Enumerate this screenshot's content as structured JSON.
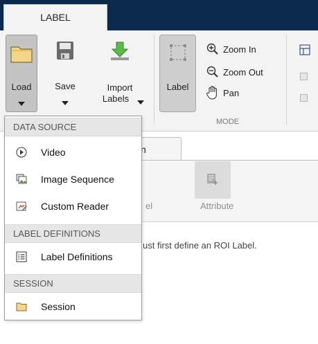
{
  "tabs": [
    {
      "label": "LABEL"
    }
  ],
  "ribbon": {
    "load": {
      "label": "Load"
    },
    "save": {
      "label": "Save"
    },
    "import": {
      "label_line1": "Import",
      "label_line2": "Labels"
    },
    "label": {
      "label": "Label"
    },
    "zoom_in": {
      "label": "Zoom In"
    },
    "zoom_out": {
      "label": "Zoom Out"
    },
    "pan": {
      "label": "Pan"
    },
    "sections": {
      "mode": "MODE"
    }
  },
  "document": {
    "tab_label_partial": "n",
    "attribute_label": "Attribute",
    "label_partial": "el",
    "hint": "ust first define an ROI Label."
  },
  "menu": {
    "sections": [
      {
        "header": "DATA SOURCE",
        "items": [
          {
            "label": "Video",
            "icon": "play-icon"
          },
          {
            "label": "Image Sequence",
            "icon": "image-sequence-icon"
          },
          {
            "label": "Custom Reader",
            "icon": "custom-reader-icon"
          }
        ]
      },
      {
        "header": "LABEL DEFINITIONS",
        "items": [
          {
            "label": "Label Definitions",
            "icon": "list-icon"
          }
        ]
      },
      {
        "header": "SESSION",
        "items": [
          {
            "label": "Session",
            "icon": "folder-icon"
          }
        ]
      }
    ]
  },
  "colors": {
    "tab_strip": "#0b2a4e",
    "ribbon": "#f3f3f3",
    "folder": "#f4d58a"
  }
}
